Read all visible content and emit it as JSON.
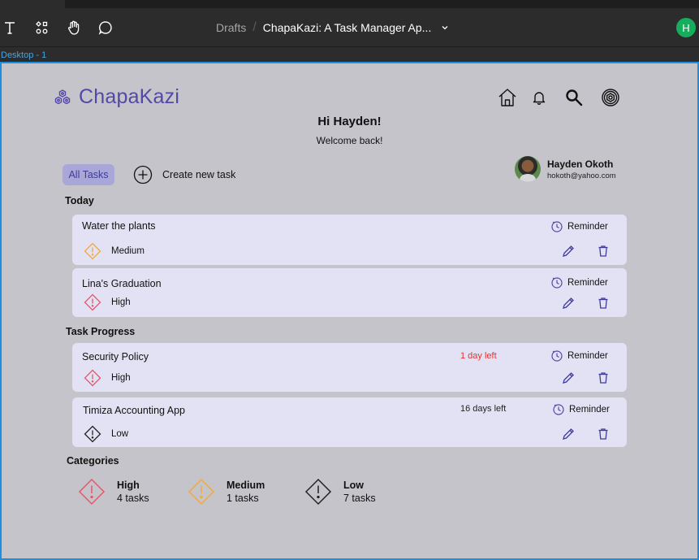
{
  "toolbar": {
    "breadcrumb_root": "Drafts",
    "breadcrumb_sep": "/",
    "file_name": "ChapaKazi: A Task Manager Ap...",
    "user_initial": "H"
  },
  "frame_label": "Desktop - 1",
  "app": {
    "logo_text": "ChapaKazi",
    "greeting": "Hi Hayden!",
    "welcome": "Welcome back!",
    "all_tasks_label": "All Tasks",
    "create_task_label": "Create new task",
    "user": {
      "name": "Hayden Okoth",
      "email": "hokoth@yahoo.com"
    },
    "sections": {
      "today": "Today",
      "progress": "Task Progress",
      "categories": "Categories"
    },
    "today_tasks": [
      {
        "title": "Water the plants",
        "priority": "Medium",
        "reminder": "Reminder"
      },
      {
        "title": "Lina's Graduation",
        "priority": "High",
        "reminder": "Reminder"
      }
    ],
    "progress_tasks": [
      {
        "title": "Security Policy",
        "due": "1 day left",
        "priority": "High",
        "reminder": "Reminder"
      },
      {
        "title": "Timiza Accounting App",
        "due": "16 days left",
        "priority": "Low",
        "reminder": "Reminder"
      }
    ],
    "categories": [
      {
        "name": "High",
        "count": "4 tasks"
      },
      {
        "name": "Medium",
        "count": "1 tasks"
      },
      {
        "name": "Low",
        "count": "7 tasks"
      }
    ]
  },
  "colors": {
    "accent": "#5348a8",
    "high": "#e5566a",
    "medium": "#f0a93a",
    "low": "#222222",
    "due_urgent": "#e5322d",
    "selection": "#1b8fe0",
    "figma_avatar": "#14ae5c"
  }
}
